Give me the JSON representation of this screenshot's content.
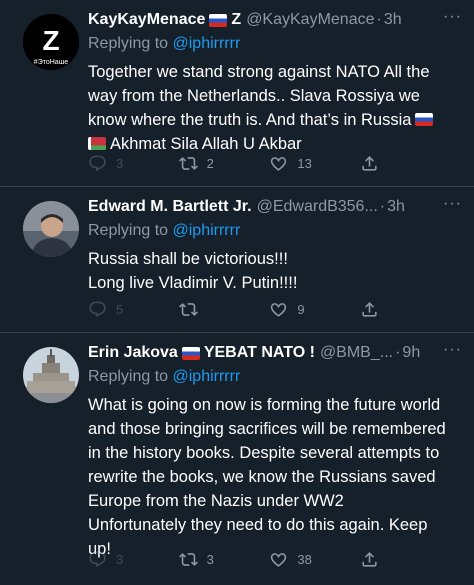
{
  "tweets": [
    {
      "name": "KayKayMenace",
      "name_suffix": "Z",
      "handle": "@KayKayMenace",
      "time": "3h",
      "avatar_label": "#ЭтоНаше",
      "avatar_letter": "Z",
      "replying_prefix": "Replying to",
      "replying_to": "@iphirrrrr",
      "lines": [
        "Together we stand strong against NATO All the",
        "way from the Netherlands.. Slava Rossiya we",
        "know where the truth is. And that’s in Russia",
        "Akhmat Sila Allah U Akbar"
      ],
      "replies": "3",
      "retweets": "2",
      "likes": "13"
    },
    {
      "name": "Edward M. Bartlett Jr.",
      "handle": "@EdwardB356...",
      "time": "3h",
      "replying_prefix": "Replying to",
      "replying_to": "@iphirrrrr",
      "lines": [
        "Russia shall be victorious!!!",
        "Long live Vladimir V. Putin!!!!"
      ],
      "replies": "5",
      "retweets": "",
      "likes": "9"
    },
    {
      "name": "Erin Jakova",
      "name_suffix": "YEBAT NATO !",
      "handle": "@BMB_...",
      "time": "9h",
      "replying_prefix": "Replying to",
      "replying_to": "@iphirrrrr",
      "lines": [
        "What is going on now is forming the future world",
        "and those bringing sacrifices will be remembered",
        "in the history books. Despite several attempts to",
        "rewrite the books, we know the Russians saved",
        "Europe from the Nazis under WW2",
        "Unfortunately they need to do this again. Keep",
        "up!"
      ],
      "replies": "3",
      "retweets": "3",
      "likes": "38"
    }
  ],
  "colors": {
    "background": "#15202b",
    "divider": "#38444d",
    "secondary_text": "#8b98a5",
    "mention": "#1d9bf0"
  },
  "icons": [
    "reply-icon",
    "retweet-icon",
    "like-icon",
    "share-icon",
    "more-options-icon",
    "russia-flag",
    "belarus-flag"
  ],
  "separator": "·",
  "more_glyph": "···"
}
